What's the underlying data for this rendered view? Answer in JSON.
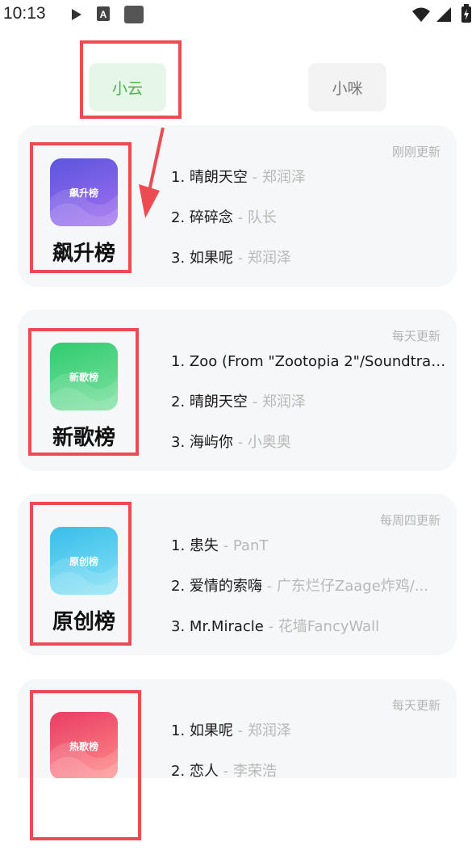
{
  "status_bar": {
    "time": "10:13"
  },
  "tabs": [
    {
      "label": "小云",
      "active": true
    },
    {
      "label": "小咪",
      "active": false
    }
  ],
  "charts": [
    {
      "name": "飙升榜",
      "cover_label": "飙升榜",
      "update": "刚刚更新",
      "gradient": [
        "#5b55de",
        "#a36ff0"
      ],
      "songs": [
        {
          "rank": "1.",
          "title": "晴朗天空",
          "artist": "郑润泽"
        },
        {
          "rank": "2.",
          "title": "碎碎念",
          "artist": "队长"
        },
        {
          "rank": "3.",
          "title": "如果呢",
          "artist": "郑润泽"
        }
      ]
    },
    {
      "name": "新歌榜",
      "cover_label": "新歌榜",
      "update": "每天更新",
      "gradient": [
        "#2fcc70",
        "#7fe1a1"
      ],
      "songs": [
        {
          "rank": "1.",
          "title": "Zoo (From \"Zootopia 2\"/Soundtrac...",
          "artist": ""
        },
        {
          "rank": "2.",
          "title": "晴朗天空",
          "artist": "郑润泽"
        },
        {
          "rank": "3.",
          "title": "海屿你",
          "artist": "小奥奥"
        }
      ]
    },
    {
      "name": "原创榜",
      "cover_label": "原创榜",
      "update": "每周四更新",
      "gradient": [
        "#38bde9",
        "#86e2f6"
      ],
      "songs": [
        {
          "rank": "1.",
          "title": "患失",
          "artist": "PanT"
        },
        {
          "rank": "2.",
          "title": "爱情的索嗨",
          "artist": "广东烂仔Zaage炸鸡/..."
        },
        {
          "rank": "3.",
          "title": "Mr.Miracle",
          "artist": "花墙FancyWall"
        }
      ]
    },
    {
      "name": "热歌榜",
      "cover_label": "热歌榜",
      "update": "每天更新",
      "gradient": [
        "#e83d63",
        "#ff8c8a"
      ],
      "songs": [
        {
          "rank": "1.",
          "title": "如果呢",
          "artist": "郑润泽"
        },
        {
          "rank": "2.",
          "title": "恋人",
          "artist": "李荣浩"
        }
      ]
    }
  ],
  "colors": {
    "accent": "#4caf50",
    "annotation": "#ec4b52"
  }
}
